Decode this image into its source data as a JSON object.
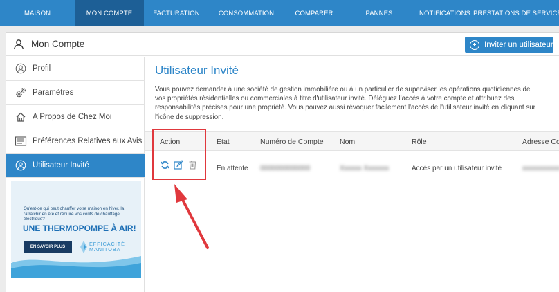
{
  "nav": {
    "items": [
      {
        "label": "MAISON",
        "active": false
      },
      {
        "label": "MON COMPTE",
        "active": true
      },
      {
        "label": "FACTURATION",
        "active": false
      },
      {
        "label": "CONSOMMATION",
        "active": false
      },
      {
        "label": "COMPARER",
        "active": false
      },
      {
        "label": "PANNES",
        "active": false
      },
      {
        "label": "NOTIFICATIONS",
        "active": false
      },
      {
        "label": "PRESTATIONS DE SERVICE",
        "active": false
      }
    ]
  },
  "header": {
    "title": "Mon Compte",
    "title_icon": "user-icon",
    "invite_button": "Inviter un utilisateur"
  },
  "sidebar": {
    "items": [
      {
        "label": "Profil",
        "icon": "user-icon"
      },
      {
        "label": "Paramètres",
        "icon": "gears-icon"
      },
      {
        "label": "A Propos de Chez Moi",
        "icon": "house-icon"
      },
      {
        "label": "Préférences Relatives aux Avis",
        "icon": "document-icon"
      },
      {
        "label": "Utilisateur Invité",
        "icon": "guest-user-icon",
        "active": true
      }
    ]
  },
  "ad": {
    "text": "Qu'est-ce qui peut chauffer votre maison en hiver, la rafraîchir en été et réduire vos coûts de chauffage électrique?",
    "headline": "UNE THERMOPOMPE À AIR!",
    "cta": "EN SAVOIR PLUS",
    "logo_line1": "EFFICACITÉ",
    "logo_line2": "MANITOBA"
  },
  "main": {
    "title": "Utilisateur Invité",
    "description": "Vous pouvez demander à une société de gestion immobilière ou à un particulier de superviser les opérations quotidiennes de vos propriétés résidentielles ou commerciales à titre d'utilisateur invité. Déléguez l'accès à votre compte et attribuez des responsabilités précises pour une propriété. Vous pouvez aussi révoquer facilement l'accès de l'utilisateur invité en cliquant sur l'icône de suppression.",
    "table": {
      "columns": [
        "Action",
        "État",
        "Numéro de Compte",
        "Nom",
        "Rôle",
        "Adresse Cour"
      ],
      "rows": [
        {
          "actions": [
            "refresh-icon",
            "edit-icon",
            "trash-icon"
          ],
          "etat": "En attente",
          "numero": "0000000000000",
          "nom": "Xxxxxx Xxxxxxx",
          "role": "Accès par un utilisateur invité",
          "adresse": "xxxxxxxxxxx"
        }
      ]
    }
  },
  "colors": {
    "brand": "#2e86c8",
    "nav_active": "#1d5f96",
    "highlight": "#e0383d"
  }
}
